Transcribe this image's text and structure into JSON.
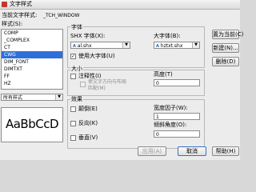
{
  "window": {
    "title": "文字样式"
  },
  "current_style": {
    "label": "当前文字样式:",
    "value": "_TCH_WINDOW"
  },
  "styles": {
    "label": "样式(S):",
    "items": [
      "COMP",
      "_COMPLEX",
      "CT",
      "CWG",
      "DIM_FONT",
      "DIMTXT",
      "FF",
      "HZ"
    ],
    "selected_index": 3
  },
  "filter": {
    "value": "所有样式"
  },
  "preview": {
    "text": "AaBbCcD"
  },
  "font": {
    "group_label": "字体",
    "shx_label": "SHX 字体(X):",
    "shx_value": "al.shx",
    "bigfont_label": "大字体(B):",
    "bigfont_value": "hztxt.shx",
    "use_bigfont_label": "使用大字体(U)",
    "use_bigfont_checked": true
  },
  "size": {
    "group_label": "大小",
    "annotative_label": "注释性(I)",
    "match_label_line1": "使文字方向与布局",
    "match_label_line2": "匹配(M)",
    "height_label": "高度(T)",
    "height_value": "0"
  },
  "effects": {
    "group_label": "效果",
    "upside_down_label": "颠倒(E)",
    "backwards_label": "反向(K)",
    "vertical_label": "垂直(V)",
    "width_factor_label": "宽度因子(W):",
    "width_factor_value": "1",
    "oblique_label": "倾斜角度(O):",
    "oblique_value": "0"
  },
  "buttons": {
    "set_current": "置为当前(C)",
    "new": "新建(N)...",
    "delete": "删除(D)",
    "apply": "应用(A)",
    "cancel": "取消",
    "help": "帮助(H)"
  }
}
